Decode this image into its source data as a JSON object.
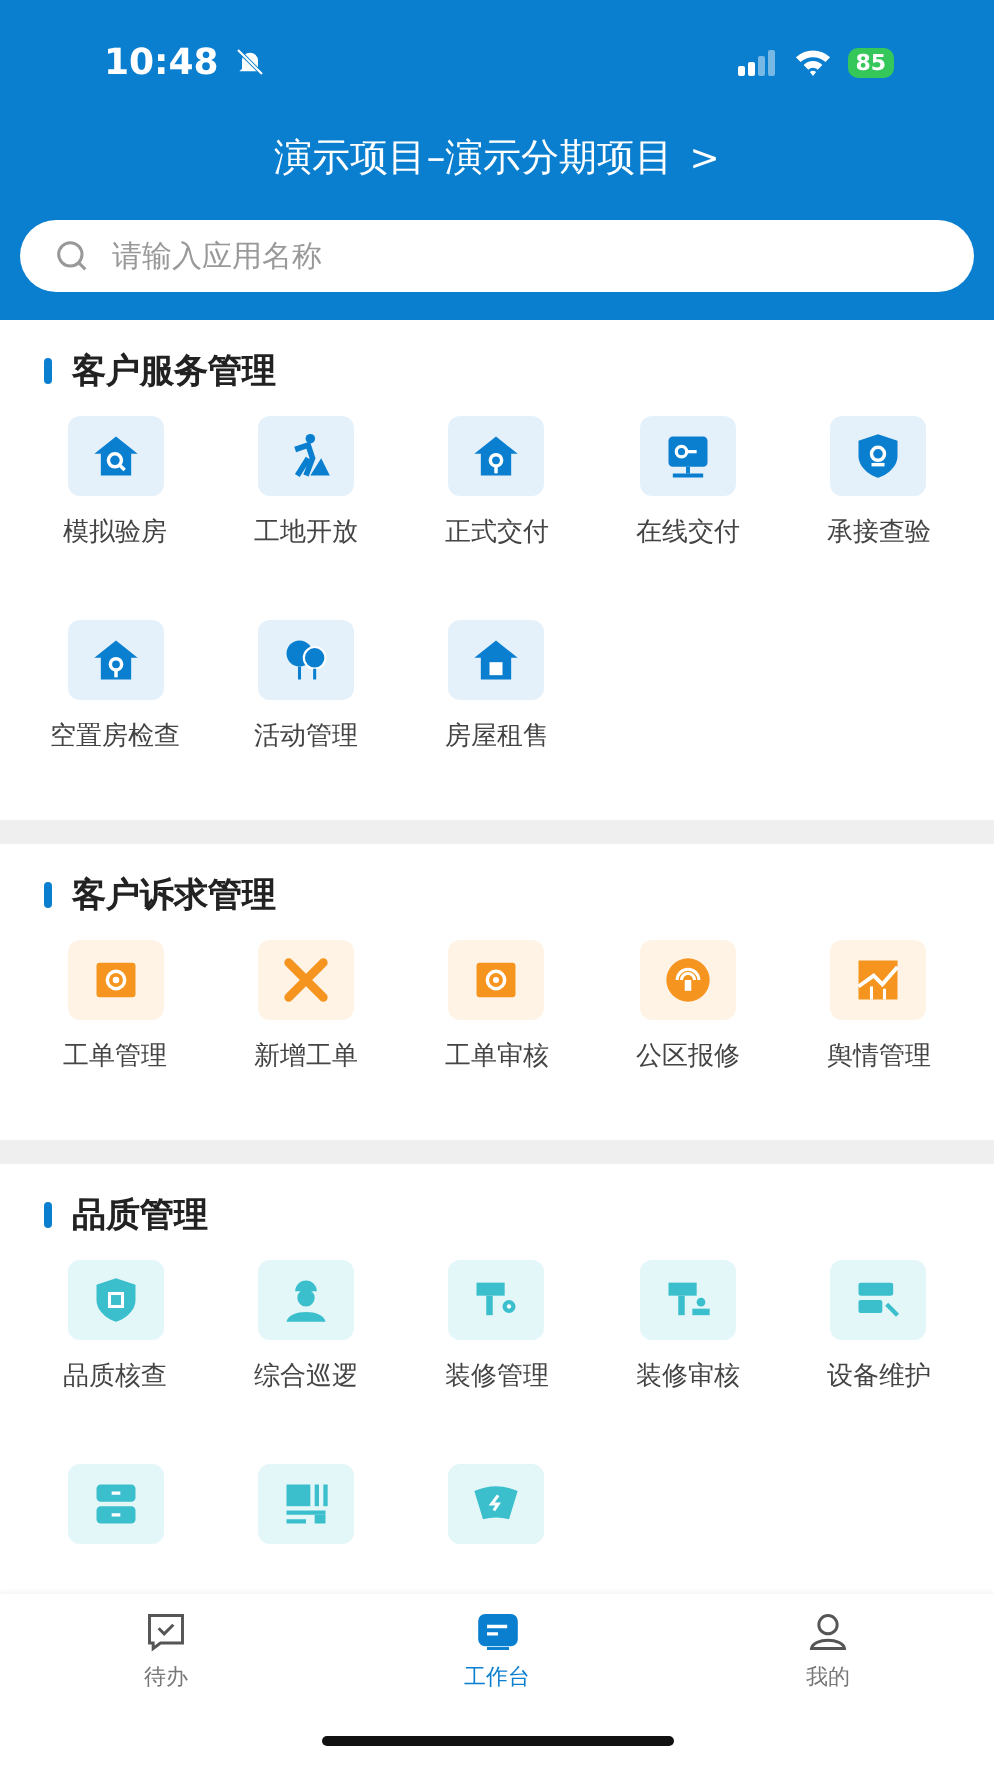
{
  "status_bar": {
    "time": "10:48",
    "battery": "85"
  },
  "header": {
    "title": "演示项目–演示分期项目",
    "chevron": ">"
  },
  "search": {
    "placeholder": "请输入应用名称"
  },
  "sections": [
    {
      "title": "客户服务管理",
      "color": "#0a7fcf",
      "items": [
        {
          "label": "模拟验房"
        },
        {
          "label": "工地开放"
        },
        {
          "label": "正式交付"
        },
        {
          "label": "在线交付"
        },
        {
          "label": "承接查验"
        },
        {
          "label": "空置房检查"
        },
        {
          "label": "活动管理"
        },
        {
          "label": "房屋租售"
        }
      ]
    },
    {
      "title": "客户诉求管理",
      "color": "#f5951f",
      "items": [
        {
          "label": "工单管理"
        },
        {
          "label": "新增工单"
        },
        {
          "label": "工单审核"
        },
        {
          "label": "公区报修"
        },
        {
          "label": "舆情管理"
        }
      ]
    },
    {
      "title": "品质管理",
      "color": "#3bbfcc",
      "items": [
        {
          "label": "品质核查",
          "kind": "app"
        },
        {
          "label": "综合巡逻",
          "kind": "app"
        },
        {
          "label": "装修管理",
          "kind": "app"
        },
        {
          "label": "装修审核",
          "kind": "app"
        },
        {
          "label": "设备维护",
          "kind": "app"
        },
        {
          "kind": "icon_only"
        },
        {
          "kind": "icon_only"
        },
        {
          "kind": "icon_only"
        }
      ]
    }
  ],
  "tabs": [
    {
      "label": "待办",
      "selected": false
    },
    {
      "label": "工作台",
      "selected": true
    },
    {
      "label": "我的",
      "selected": false
    }
  ]
}
